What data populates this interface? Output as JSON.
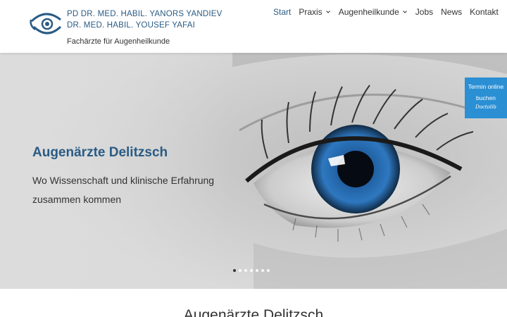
{
  "brand": {
    "line1": "PD DR. MED. HABIL. YANORS YANDIEV",
    "line2": "DR. MED. HABIL. YOUSEF YAFAI",
    "tagline": "Fachärzte für Augenheilkunde",
    "logo_icon": "eye-logo-icon"
  },
  "nav": {
    "items": [
      {
        "label": "Start",
        "active": true
      },
      {
        "label": "Praxis",
        "dropdown": true
      },
      {
        "label": "Augenheilkunde",
        "dropdown": true
      },
      {
        "label": "Jobs"
      },
      {
        "label": "News"
      },
      {
        "label": "Kontakt"
      }
    ]
  },
  "hero": {
    "title": "Augenärzte Delitzsch",
    "subtitle": "Wo Wissenschaft und klinische Erfahrung zusammen kommen",
    "slides": 7,
    "active_slide": 1
  },
  "booking": {
    "label": "Termin online buchen",
    "provider": "Doctolib"
  },
  "section": {
    "title": "Augenärzte Delitzsch"
  },
  "colors": {
    "accent": "#2a5b84",
    "booking": "#2b8fd4",
    "iris": "#1f5d9e",
    "text": "#333333"
  }
}
